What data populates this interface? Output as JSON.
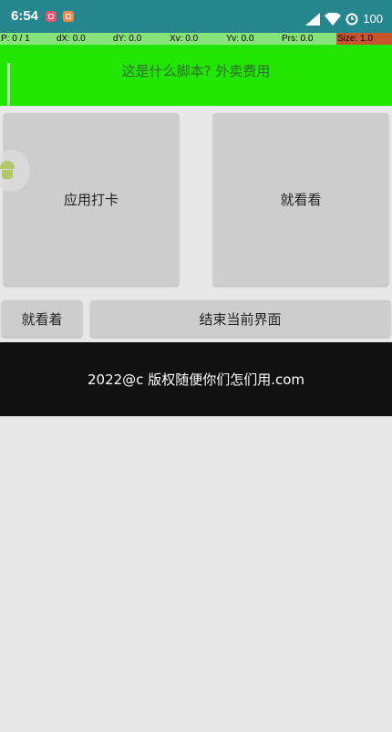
{
  "status_bar": {
    "time": "6:54",
    "battery": "100",
    "notification_icons": [
      "alarm-app-icon",
      "mi-app-icon"
    ],
    "system_icons": [
      "signal-icon",
      "wifi-icon",
      "alarm-clock-icon"
    ]
  },
  "pointer_location": {
    "p": "P: 0 / 1",
    "dx": "dX: 0.0",
    "dy": "dY: 0.0",
    "xv": "Xv: 0.0",
    "yv": "Yv: 0.0",
    "prs": "Prs: 0.0",
    "size": "Size: 1.0"
  },
  "header": {
    "title": "这是什么脚本? 外卖费用",
    "background": "#22e600"
  },
  "buttons": {
    "clock_in": "应用打卡",
    "look_1": "就看看",
    "look_2": "就看着",
    "end_page": "结束当前界面"
  },
  "footer": {
    "text": "2022@c 版权随便你们怎们用.com"
  },
  "colors": {
    "status_bar": "#25878d",
    "pointer_bar": "#87e37a",
    "size_cell": "#c8552e",
    "button": "#cdcdcd",
    "footer": "#111111",
    "page": "#e8e8e8"
  }
}
